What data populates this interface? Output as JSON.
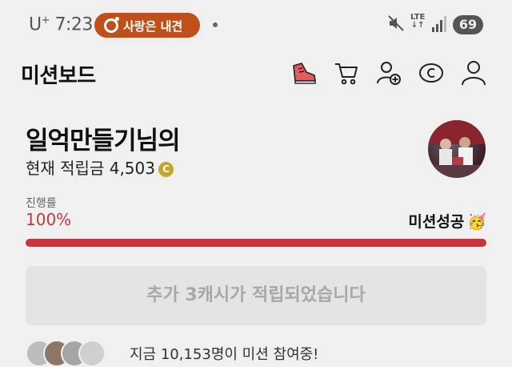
{
  "status_bar": {
    "carrier": "U",
    "carrier_sup": "+",
    "time": "7:23",
    "notification_pill": "사랑은 내견",
    "network": "LTE",
    "battery": "69"
  },
  "header": {
    "title": "미션보드",
    "icons": [
      "shoe-icon",
      "cart-icon",
      "add-friend-icon",
      "cash-icon",
      "profile-icon"
    ]
  },
  "profile": {
    "name": "일억만들기님의",
    "points_label": "현재 적립금",
    "points_value": "4,503",
    "coin_symbol": "C"
  },
  "progress": {
    "label": "진행률",
    "percent_text": "100%",
    "value": 1.0,
    "status": "미션성공",
    "status_emoji": "🥳",
    "color": "#c8363c"
  },
  "notice": {
    "text": "추가 3캐시가 적립되었습니다"
  },
  "participants": {
    "text": "지금 10,153명이 미션 참여중!"
  }
}
